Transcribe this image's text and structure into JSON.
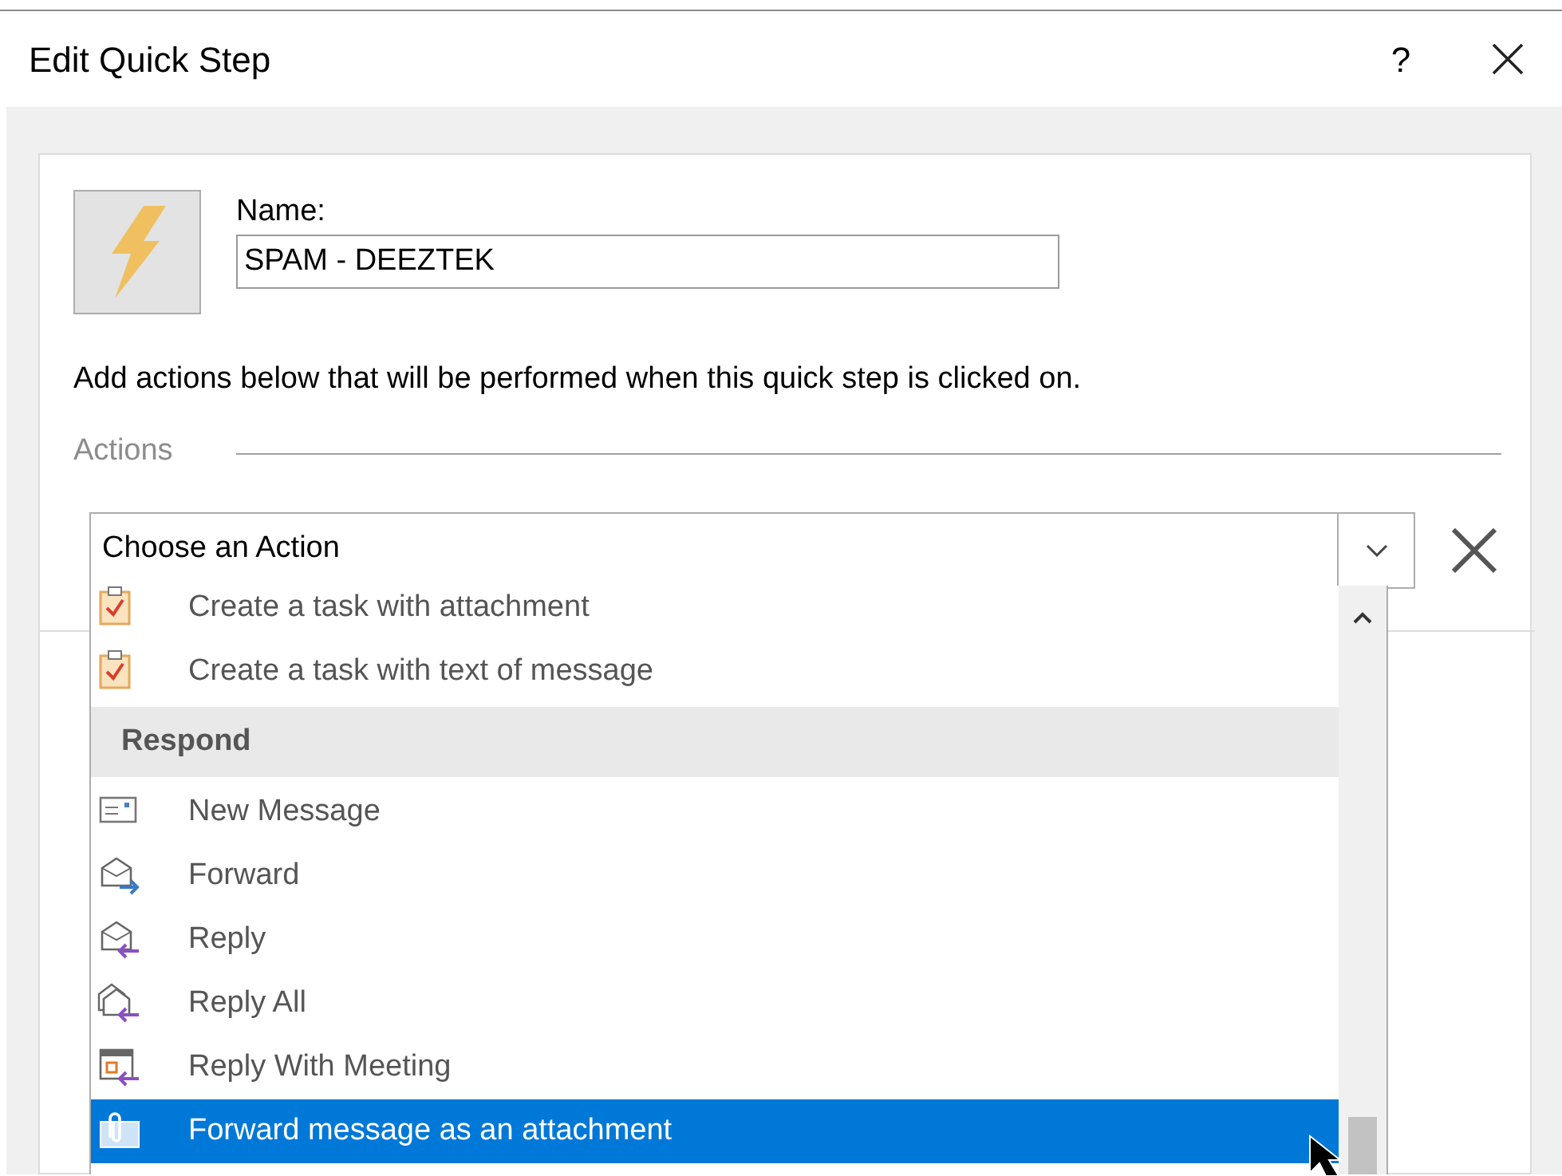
{
  "window": {
    "title": "Edit Quick Step",
    "help": "?"
  },
  "name_field": {
    "label": "Name:",
    "value": "SPAM - DEEZTEK"
  },
  "instruction": "Add actions below that will be performed when this quick step is clicked on.",
  "actions_section": {
    "title": "Actions"
  },
  "action_dropdown": {
    "value": "Choose an Action",
    "expanded": true
  },
  "action_list": [
    {
      "kind": "task",
      "label": "Create a task with attachment",
      "selected": false
    },
    {
      "kind": "task",
      "label": "Create a task with text of message",
      "selected": false
    },
    {
      "kind": "header",
      "label": "Respond"
    },
    {
      "kind": "new-message",
      "label": "New Message",
      "selected": false
    },
    {
      "kind": "forward",
      "label": "Forward",
      "selected": false
    },
    {
      "kind": "reply",
      "label": "Reply",
      "selected": false
    },
    {
      "kind": "reply-all",
      "label": "Reply All",
      "selected": false
    },
    {
      "kind": "meeting",
      "label": "Reply With Meeting",
      "selected": false
    },
    {
      "kind": "attachment",
      "label": "Forward message as an attachment",
      "selected": true
    }
  ]
}
